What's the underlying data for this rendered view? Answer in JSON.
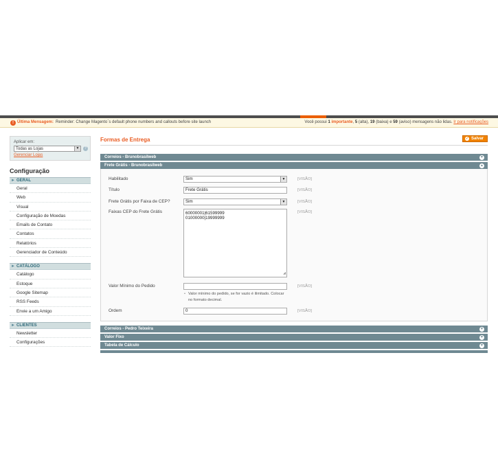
{
  "message_bar": {
    "warn_icon": "!",
    "label": "Última Mensagem:",
    "text": "Reminder: Change Magento`s default phone numbers and callouts before site launch",
    "summary_prefix": "Você possui",
    "count_important": "1",
    "important_label": "importante",
    "count_high": "5",
    "high_label": "(alta),",
    "count_low": "19",
    "low_label": "(baixa) e",
    "count_notice": "59",
    "notice_label": "(aviso) mensagens não lidas.",
    "link": "Ir para notificações"
  },
  "scope_switcher": {
    "label": "Aplicar em:",
    "selected": "Todas as Lojas",
    "manage_link": "Gerenciar Lojas"
  },
  "sidebar": {
    "title": "Configuração",
    "groups": [
      {
        "label": "GERAL",
        "items": [
          "Geral",
          "Web",
          "Visual",
          "Configuração de Moedas",
          "Emails de Contato",
          "Contatos",
          "Relatórios",
          "Gerenciador de Conteúdo"
        ]
      },
      {
        "label": "CATÁLOGO",
        "items": [
          "Catálogo",
          "Estoque",
          "Google Sitemap",
          "RSS Feeds",
          "Envie a um Amigo"
        ]
      },
      {
        "label": "CLIENTES",
        "items": [
          "Newsletter",
          "Configurações"
        ]
      }
    ]
  },
  "main": {
    "title": "Formas de Entrega",
    "save_label": "Salvar",
    "sections": {
      "correios_bruno": "Correios - Brunobrasilweb",
      "frete_gratis": "Frete Grátis - Brunobrasilweb",
      "correios_pedro": "Correios - Pedro Teixeira",
      "valor_fixo": "Valor Fixo",
      "tabela_calculo": "Tabela de Cálculo"
    },
    "form": {
      "enabled_label": "Habilitado",
      "enabled_value": "Sim",
      "title_label": "Título",
      "title_value": "Frete Grátis",
      "by_zip_label": "Frete Grátis por Faixa de CEP?",
      "by_zip_value": "Sim",
      "zip_ranges_label": "Faixas CEP do Frete Grátis",
      "zip_range_1": "60000001|61599999",
      "zip_range_2": "01000000|19999999",
      "min_order_label": "Valor Mínimo do Pedido",
      "min_order_value": "",
      "min_order_note_1": "Valor mínimo do pedido, se for vazio é ilimitado. Colocar",
      "min_order_note_2": "no formato decimal.",
      "order_label": "Ordem",
      "order_value": "0",
      "scope": "[VISÃO]"
    }
  },
  "colors": {
    "accent": "#e95d24",
    "section_header": "#6f8992",
    "sidebar_group": "#d1dedf"
  }
}
